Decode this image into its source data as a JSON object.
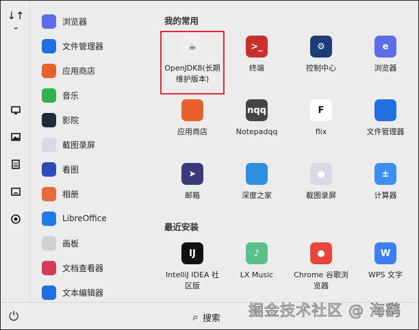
{
  "rail": {
    "sort_icon": "↓↑",
    "chevron": "⌄"
  },
  "app_list": [
    {
      "label": "浏览器",
      "color": "#5b6ee8"
    },
    {
      "label": "文件管理器",
      "color": "#1f6fe0"
    },
    {
      "label": "应用商店",
      "color": "#e8602c"
    },
    {
      "label": "音乐",
      "color": "#2fb24a"
    },
    {
      "label": "影院",
      "color": "#1d2b3a"
    },
    {
      "label": "截图录屏",
      "color": "#d8dbe6"
    },
    {
      "label": "看图",
      "color": "#2a4bb8"
    },
    {
      "label": "相册",
      "color": "#e86a3a"
    },
    {
      "label": "LibreOffice",
      "color": "#1e7be6"
    },
    {
      "label": "画板",
      "color": "#cfcfd6"
    },
    {
      "label": "文档查看器",
      "color": "#d63a5a"
    },
    {
      "label": "文本编辑器",
      "color": "#1e6fe0"
    }
  ],
  "favorites": {
    "title": "我的常用",
    "apps": [
      {
        "label": "OpenJDK8(长期维护版本)",
        "color": "#eeeeee",
        "glyph": "☕"
      },
      {
        "label": "终端",
        "color": "#c9302c",
        "glyph": ">_"
      },
      {
        "label": "控制中心",
        "color": "#1d3d78",
        "glyph": "⚙"
      },
      {
        "label": "浏览器",
        "color": "#5b6ee8",
        "glyph": "e"
      },
      {
        "label": "应用商店",
        "color": "#e8602c",
        "glyph": ""
      },
      {
        "label": "Notepadqq",
        "color": "#444444",
        "glyph": "nqq"
      },
      {
        "label": "flix",
        "color": "#ffffff",
        "glyph": "F"
      },
      {
        "label": "文件管理器",
        "color": "#1f6fe0",
        "glyph": ""
      },
      {
        "label": "邮箱",
        "color": "#3a3a7a",
        "glyph": "➤"
      },
      {
        "label": "深度之家",
        "color": "#2c8fe0",
        "glyph": ""
      },
      {
        "label": "截图录屏",
        "color": "#d8dbe6",
        "glyph": "●"
      },
      {
        "label": "计算器",
        "color": "#3d8ef0",
        "glyph": "±"
      }
    ]
  },
  "recent": {
    "title": "最近安装",
    "apps": [
      {
        "label": "IntelliJ IDEA 社区版",
        "color": "#111111",
        "glyph": "IJ"
      },
      {
        "label": "LX Music",
        "color": "#5cc08a",
        "glyph": "♪"
      },
      {
        "label": "Chrome 谷歌浏览器",
        "color": "#e8453c",
        "glyph": "●"
      },
      {
        "label": "WPS 文字",
        "color": "#3d7ff0",
        "glyph": "W"
      }
    ]
  },
  "bottom": {
    "search_label": "搜索",
    "search_icon": "⌕",
    "power_icon": "⏻"
  },
  "watermark": "掘金技术社区 @ 海鹞"
}
